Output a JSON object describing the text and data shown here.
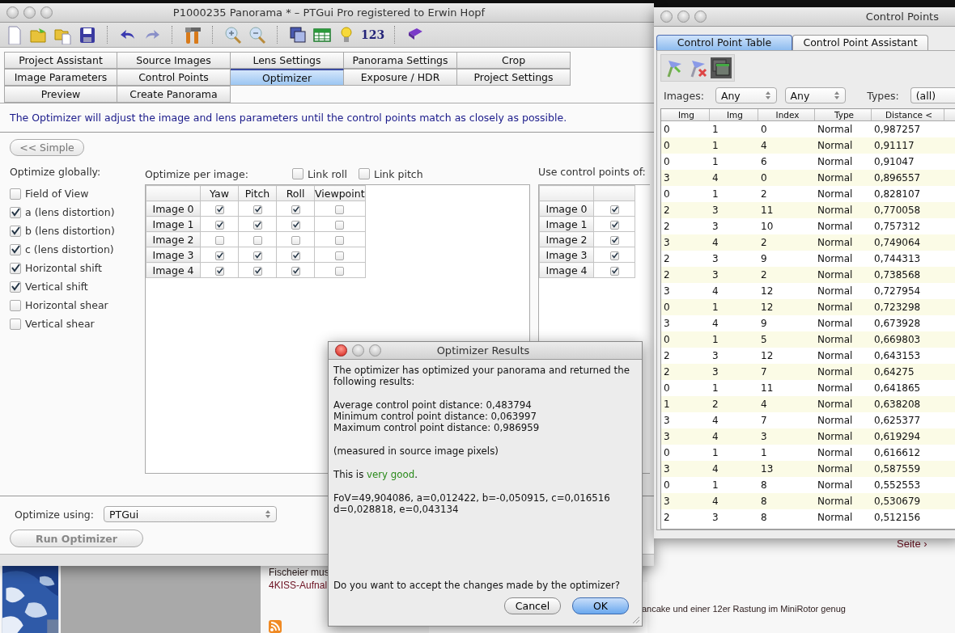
{
  "desktop": {
    "web_texts": [
      {
        "kind": "plain",
        "text": "Fischeier mus"
      },
      {
        "kind": "link",
        "text": "4KISS-Aufnal"
      },
      {
        "kind": "link",
        "text": "Seite ›"
      },
      {
        "kind": "plain",
        "text": "ancake und einer 12er Rastung im MiniRotor genug"
      }
    ]
  },
  "main_window": {
    "title": "P1000235 Panorama * – PTGui Pro registered to Erwin Hopf",
    "toolbar_number": "123",
    "tabs": [
      [
        {
          "label": "Project Assistant",
          "selected": false
        },
        {
          "label": "Source Images",
          "selected": false
        },
        {
          "label": "Lens Settings",
          "selected": false
        },
        {
          "label": "Panorama Settings",
          "selected": false
        },
        {
          "label": "Crop",
          "selected": false
        }
      ],
      [
        {
          "label": "Image Parameters",
          "selected": false
        },
        {
          "label": "Control Points",
          "selected": false
        },
        {
          "label": "Optimizer",
          "selected": true
        },
        {
          "label": "Exposure / HDR",
          "selected": false
        },
        {
          "label": "Project Settings",
          "selected": false
        }
      ],
      [
        {
          "label": "Preview",
          "selected": false
        },
        {
          "label": "Create Panorama",
          "selected": false
        }
      ]
    ],
    "description": "The Optimizer will adjust the image and lens parameters until the control points match as closely as possible.",
    "simple_button": "<< Simple",
    "optimize_globally": {
      "label": "Optimize globally:",
      "items": [
        {
          "label": "Field of View",
          "checked": false
        },
        {
          "label": "a (lens distortion)",
          "checked": true
        },
        {
          "label": "b (lens distortion)",
          "checked": true
        },
        {
          "label": "c (lens distortion)",
          "checked": true
        },
        {
          "label": "Horizontal shift",
          "checked": true
        },
        {
          "label": "Vertical shift",
          "checked": true
        },
        {
          "label": "Horizontal shear",
          "checked": false
        },
        {
          "label": "Vertical shear",
          "checked": false
        }
      ]
    },
    "per_image": {
      "label": "Optimize per image:",
      "links": [
        {
          "label": "Link roll",
          "checked": false
        },
        {
          "label": "Link pitch",
          "checked": false
        }
      ],
      "columns": [
        "Yaw",
        "Pitch",
        "Roll",
        "Viewpoint"
      ],
      "rows": [
        {
          "label": "Image 0",
          "checks": [
            true,
            true,
            true,
            false
          ]
        },
        {
          "label": "Image 1",
          "checks": [
            true,
            true,
            true,
            false
          ]
        },
        {
          "label": "Image 2",
          "checks": [
            false,
            false,
            false,
            false
          ]
        },
        {
          "label": "Image 3",
          "checks": [
            true,
            true,
            true,
            false
          ]
        },
        {
          "label": "Image 4",
          "checks": [
            true,
            true,
            true,
            false
          ]
        }
      ]
    },
    "use_control_points": {
      "label": "Use control points of:",
      "rows": [
        {
          "label": "Image 0",
          "checked": true
        },
        {
          "label": "Image 1",
          "checked": true
        },
        {
          "label": "Image 2",
          "checked": true
        },
        {
          "label": "Image 3",
          "checked": true
        },
        {
          "label": "Image 4",
          "checked": true
        }
      ]
    },
    "optimize_using": {
      "label": "Optimize using:",
      "value": "PTGui"
    },
    "run_button": {
      "label": "Run Optimizer",
      "disabled": true
    }
  },
  "control_points_window": {
    "title": "Control Points",
    "tabs": [
      {
        "label": "Control Point Table",
        "selected": true
      },
      {
        "label": "Control Point Assistant",
        "selected": false
      }
    ],
    "images_label": "Images:",
    "image_filters": [
      "Any",
      "Any"
    ],
    "types_label": "Types:",
    "types_value": "(all)",
    "columns": [
      "Img",
      "Img",
      "Index",
      "Type",
      "Distance <"
    ],
    "rows": [
      [
        "0",
        "1",
        "0",
        "Normal",
        "0,987257"
      ],
      [
        "0",
        "1",
        "4",
        "Normal",
        "0,91117"
      ],
      [
        "0",
        "1",
        "6",
        "Normal",
        "0,91047"
      ],
      [
        "3",
        "4",
        "0",
        "Normal",
        "0,896557"
      ],
      [
        "0",
        "1",
        "2",
        "Normal",
        "0,828107"
      ],
      [
        "2",
        "3",
        "11",
        "Normal",
        "0,770058"
      ],
      [
        "2",
        "3",
        "10",
        "Normal",
        "0,757312"
      ],
      [
        "3",
        "4",
        "2",
        "Normal",
        "0,749064"
      ],
      [
        "2",
        "3",
        "9",
        "Normal",
        "0,744313"
      ],
      [
        "2",
        "3",
        "2",
        "Normal",
        "0,738568"
      ],
      [
        "3",
        "4",
        "12",
        "Normal",
        "0,727954"
      ],
      [
        "0",
        "1",
        "12",
        "Normal",
        "0,723298"
      ],
      [
        "3",
        "4",
        "9",
        "Normal",
        "0,673928"
      ],
      [
        "0",
        "1",
        "5",
        "Normal",
        "0,669803"
      ],
      [
        "2",
        "3",
        "12",
        "Normal",
        "0,643153"
      ],
      [
        "2",
        "3",
        "7",
        "Normal",
        "0,64275"
      ],
      [
        "0",
        "1",
        "11",
        "Normal",
        "0,641865"
      ],
      [
        "1",
        "2",
        "4",
        "Normal",
        "0,638208"
      ],
      [
        "3",
        "4",
        "7",
        "Normal",
        "0,625377"
      ],
      [
        "3",
        "4",
        "3",
        "Normal",
        "0,619294"
      ],
      [
        "0",
        "1",
        "1",
        "Normal",
        "0,616612"
      ],
      [
        "3",
        "4",
        "13",
        "Normal",
        "0,587559"
      ],
      [
        "0",
        "1",
        "8",
        "Normal",
        "0,552553"
      ],
      [
        "3",
        "4",
        "8",
        "Normal",
        "0,530679"
      ],
      [
        "2",
        "3",
        "8",
        "Normal",
        "0,512156"
      ]
    ]
  },
  "dialog": {
    "title": "Optimizer Results",
    "intro": "The optimizer has optimized your panorama and returned the following results:",
    "stats": [
      "Average control point distance: 0,483794",
      "Minimum control point distance: 0,063997",
      "Maximum control point distance: 0,986959"
    ],
    "note": "(measured in source image pixels)",
    "verdict": {
      "before": "This is ",
      "rating": "very good",
      "after": "."
    },
    "parameters": [
      "FoV=49,904086, a=0,012422, b=-0,050915, c=0,016516",
      "d=0,028818, e=0,043134"
    ],
    "question": "Do you want to accept the changes made by the optimizer?",
    "buttons": [
      {
        "label": "Cancel",
        "default": false
      },
      {
        "label": "OK",
        "default": true
      }
    ]
  }
}
